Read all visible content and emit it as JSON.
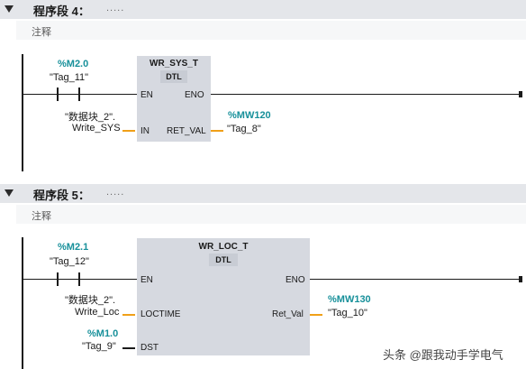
{
  "networks": [
    {
      "title": "程序段 4：",
      "dots": ".....",
      "comment": "注释",
      "contact": {
        "address": "%M2.0",
        "tag": "\"Tag_11\""
      },
      "block": {
        "name": "WR_SYS_T",
        "type": "DTL",
        "pins": {
          "en": "EN",
          "eno": "ENO",
          "in": "IN",
          "out": "RET_VAL"
        }
      },
      "in_operand": {
        "line1": "\"数据块_2\".",
        "line2": "Write_SYS"
      },
      "out_operand": {
        "address": "%MW120",
        "tag": "\"Tag_8\""
      }
    },
    {
      "title": "程序段 5：",
      "dots": ".....",
      "comment": "注释",
      "contact": {
        "address": "%M2.1",
        "tag": "\"Tag_12\""
      },
      "block": {
        "name": "WR_LOC_T",
        "type": "DTL",
        "pins": {
          "en": "EN",
          "eno": "ENO",
          "loctime": "LOCTIME",
          "dst": "DST",
          "out": "Ret_Val"
        }
      },
      "in_operand": {
        "line1": "\"数据块_2\".",
        "line2": "Write_Loc"
      },
      "dst_operand": {
        "address": "%M1.0",
        "tag": "\"Tag_9\""
      },
      "out_operand": {
        "address": "%MW130",
        "tag": "\"Tag_10\""
      }
    }
  ],
  "watermark": "头条 @跟我动手学电气",
  "colors": {
    "address": "#17909a",
    "connector": "#f0a018",
    "header_bg": "#e4e6ea",
    "block_bg": "#d6d9e0"
  }
}
